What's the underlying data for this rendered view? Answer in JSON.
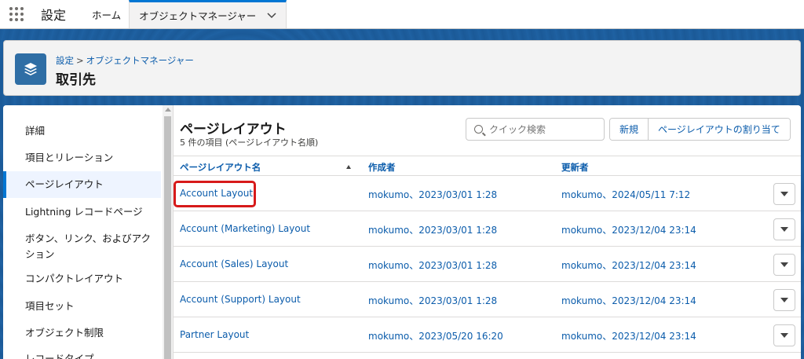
{
  "nav": {
    "app_name": "設定",
    "tabs": [
      {
        "label": "ホーム"
      },
      {
        "label": "オブジェクトマネージャー"
      }
    ]
  },
  "header": {
    "breadcrumb": [
      "設定",
      "オブジェクトマネージャー"
    ],
    "breadcrumb_separator": ">",
    "title": "取引先",
    "icon": "layers-icon"
  },
  "sidebar": {
    "items": [
      {
        "label": "詳細"
      },
      {
        "label": "項目とリレーション"
      },
      {
        "label": "ページレイアウト",
        "active": true
      },
      {
        "label": "Lightning レコードページ"
      },
      {
        "label": "ボタン、リンク、およびアクション"
      },
      {
        "label": "コンパクトレイアウト"
      },
      {
        "label": "項目セット"
      },
      {
        "label": "オブジェクト制限"
      },
      {
        "label": "レコードタイプ"
      }
    ]
  },
  "main": {
    "title": "ページレイアウト",
    "subtitle": "5 件の項目 (ページレイアウト名順)",
    "search_placeholder": "クイック検索",
    "buttons": {
      "new": "新規",
      "assign": "ページレイアウトの割り当て"
    },
    "columns": [
      "ページレイアウト名",
      "作成者",
      "更新者"
    ],
    "rows": [
      {
        "name": "Account Layout",
        "created": "mokumo、2023/03/01 1:28",
        "modified": "mokumo、2024/05/11 7:12"
      },
      {
        "name": "Account (Marketing) Layout",
        "created": "mokumo、2023/03/01 1:28",
        "modified": "mokumo、2023/12/04 23:14"
      },
      {
        "name": "Account (Sales) Layout",
        "created": "mokumo、2023/03/01 1:28",
        "modified": "mokumo、2023/12/04 23:14"
      },
      {
        "name": "Account (Support) Layout",
        "created": "mokumo、2023/03/01 1:28",
        "modified": "mokumo、2023/12/04 23:14"
      },
      {
        "name": "Partner Layout",
        "created": "mokumo、2023/05/20 16:20",
        "modified": "mokumo、2023/12/04 23:14"
      }
    ]
  },
  "colors": {
    "brand": "#0176d3",
    "link": "#0b5cab",
    "highlight": "#d71a1a",
    "band": "#1b5a98"
  }
}
